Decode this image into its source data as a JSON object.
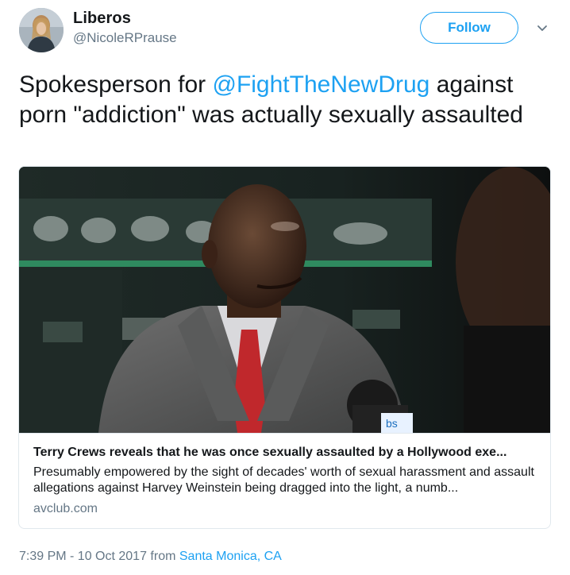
{
  "user": {
    "display_name": "Liberos",
    "handle": "@NicoleRPrause"
  },
  "header": {
    "follow_label": "Follow",
    "menu_icon": "chevron-down-icon"
  },
  "tweet": {
    "text_prefix": "Spokesperson for ",
    "mention": "@FightTheNewDrug",
    "text_suffix": " against porn \"addiction\" was actually sexually assaulted"
  },
  "card": {
    "title": "Terry Crews reveals that he was once sexually assaulted by a Hollywood exe...",
    "description": "Presumably empowered by the sight of decades' worth of sexual harassment and assault allegations against Harvey Weinstein being dragged into the light, a numb...",
    "domain": "avclub.com"
  },
  "footer": {
    "time": "7:39 PM - 10 Oct 2017 from ",
    "location": "Santa Monica, CA"
  },
  "colors": {
    "accent": "#1da1f2",
    "text": "#14171a",
    "muted": "#657786",
    "border": "#e1e8ed"
  }
}
